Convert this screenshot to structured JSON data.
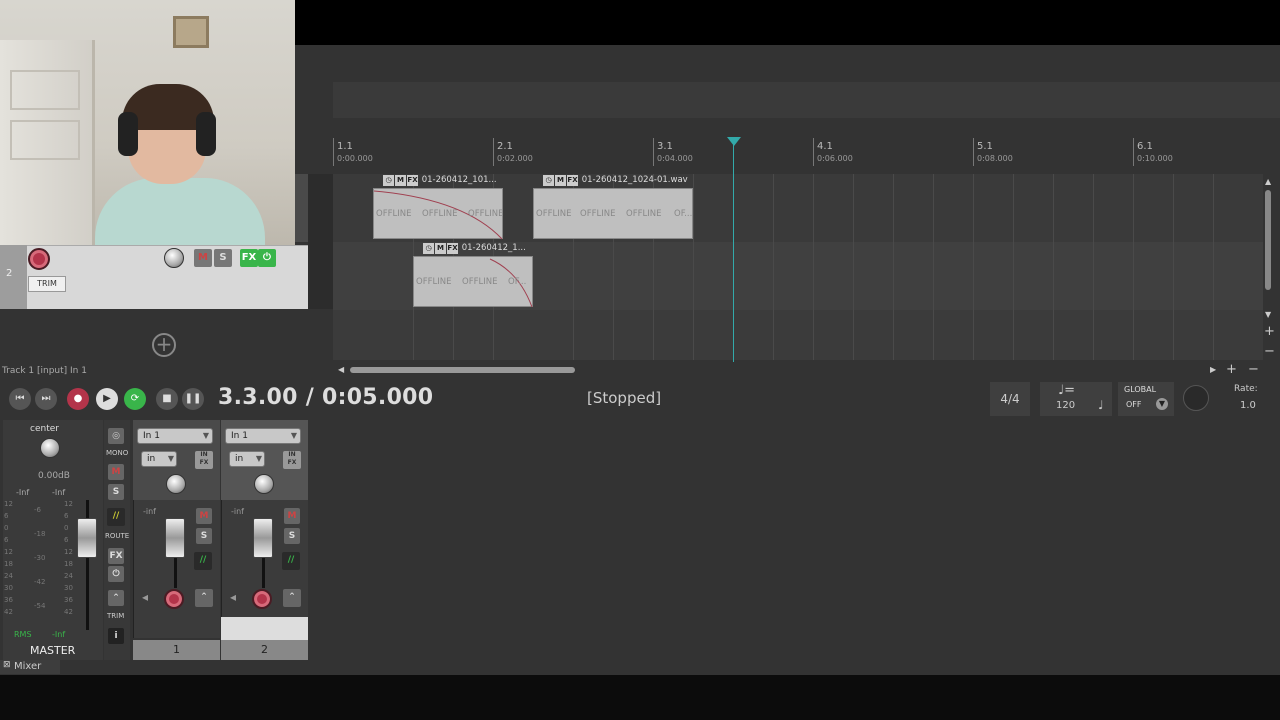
{
  "arrange": {
    "ruler": [
      {
        "measure": "1.1",
        "time": "0:00.000"
      },
      {
        "measure": "2.1",
        "time": "0:02.000"
      },
      {
        "measure": "3.1",
        "time": "0:04.000"
      },
      {
        "measure": "4.1",
        "time": "0:06.000"
      },
      {
        "measure": "5.1",
        "time": "0:08.000"
      },
      {
        "measure": "6.1",
        "time": "0:10.000"
      }
    ],
    "items": [
      {
        "name": "01-260412_101...",
        "m": "M",
        "fx": "FX",
        "offline": [
          "OFFLINE",
          "OFFLINE",
          "OFFLINE"
        ]
      },
      {
        "name": "01-260412_1024-01.wav",
        "m": "M",
        "fx": "FX",
        "offline": [
          "OFFLINE",
          "OFFLINE",
          "OFFLINE",
          "OF..."
        ]
      },
      {
        "name": "01-260412_1...",
        "m": "M",
        "fx": "FX",
        "offline": [
          "OFFLINE",
          "OFFLINE",
          "OF..."
        ]
      }
    ]
  },
  "tcp": {
    "track_number": "2",
    "mute": "M",
    "solo": "S",
    "fx": "FX",
    "trim": "TRIM",
    "status_line": "Track 1 [input] In 1"
  },
  "transport": {
    "time": "3.3.00 / 0:05.000",
    "status": "[Stopped]",
    "timesig": "4/4",
    "tempo": "120",
    "global_label": "GLOBAL",
    "global_state": "OFF",
    "rate_label": "Rate:",
    "rate_value": "1.0"
  },
  "mixer": {
    "tab_label": "Mixer",
    "master": {
      "pan_label": "center",
      "db": "0.00dB",
      "peak_l": "-Inf",
      "peak_r": "-Inf",
      "rms_label": "RMS",
      "rms_value": "-Inf",
      "name": "MASTER",
      "mono": "MONO",
      "route": "ROUTE",
      "trim": "TRIM",
      "m": "M",
      "s": "S",
      "fx": "FX",
      "info": "i",
      "scale_left": [
        "12",
        "6",
        "0",
        "6",
        "12",
        "18",
        "24",
        "30",
        "36",
        "42"
      ],
      "scale_mid": [
        "-6",
        "-18",
        "-30",
        "-42",
        "-54"
      ],
      "scale_right": [
        "12",
        "6",
        "0",
        "6",
        "12",
        "18",
        "24",
        "30",
        "36",
        "42"
      ]
    },
    "strips": [
      {
        "input": "In 1",
        "mode": "in",
        "infx": "IN FX",
        "peak": "-inf",
        "m": "M",
        "s": "S",
        "number": "1"
      },
      {
        "input": "In 1",
        "mode": "in",
        "infx": "IN FX",
        "peak": "-inf",
        "m": "M",
        "s": "S",
        "number": "2"
      }
    ]
  },
  "colors": {
    "accent": "#33aaaa",
    "record": "#b3344a",
    "fx_green": "#39b54a"
  }
}
